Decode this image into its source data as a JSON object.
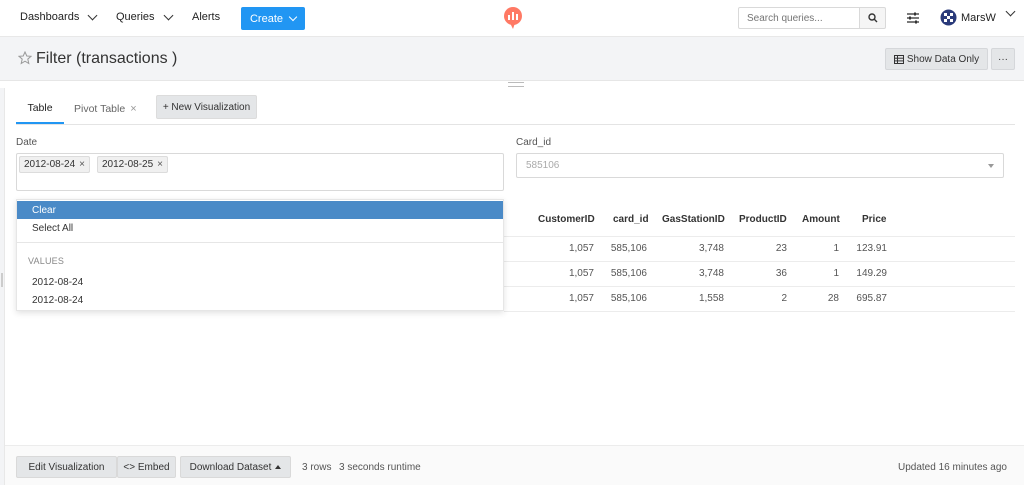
{
  "navbar": {
    "dashboards_label": "Dashboards",
    "queries_label": "Queries",
    "alerts_label": "Alerts",
    "create_label": "Create",
    "search_placeholder": "Search queries...",
    "user_name": "MarsW",
    "accent_color": "#2196f3"
  },
  "header": {
    "title": "Filter (transactions )",
    "show_data_label": "Show Data Only",
    "more_label": "···"
  },
  "tabs": [
    {
      "label": "Table",
      "active": true
    },
    {
      "label": "Pivot Table",
      "close": "×"
    }
  ],
  "new_vis_label": "+ New Visualization",
  "filters": {
    "date": {
      "label": "Date",
      "tags": [
        "2012-08-24",
        "2012-08-25"
      ],
      "tag_close": "×"
    },
    "card_id": {
      "label": "Card_id",
      "value": "585106"
    }
  },
  "dropdown": {
    "items": [
      "Clear",
      "Select All"
    ],
    "group_label": "VALUES",
    "values": [
      "2012-08-24",
      "2012-08-24"
    ]
  },
  "table": {
    "columns": [
      "CustomerID",
      "card_id",
      "GasStationID",
      "ProductID",
      "Amount",
      "Price"
    ],
    "rows": [
      [
        "1,057",
        "585,106",
        "3,748",
        "23",
        "1",
        "123.91"
      ],
      [
        "1,057",
        "585,106",
        "3,748",
        "36",
        "1",
        "149.29"
      ],
      [
        "1,057",
        "585,106",
        "1,558",
        "2",
        "28",
        "695.87"
      ]
    ]
  },
  "footer": {
    "edit_label": "Edit Visualization",
    "embed_label": "<> Embed",
    "download_label": "Download Dataset",
    "rows_text": "3 rows",
    "runtime_text": "3 seconds runtime",
    "updated_text": "Updated 16 minutes ago"
  }
}
